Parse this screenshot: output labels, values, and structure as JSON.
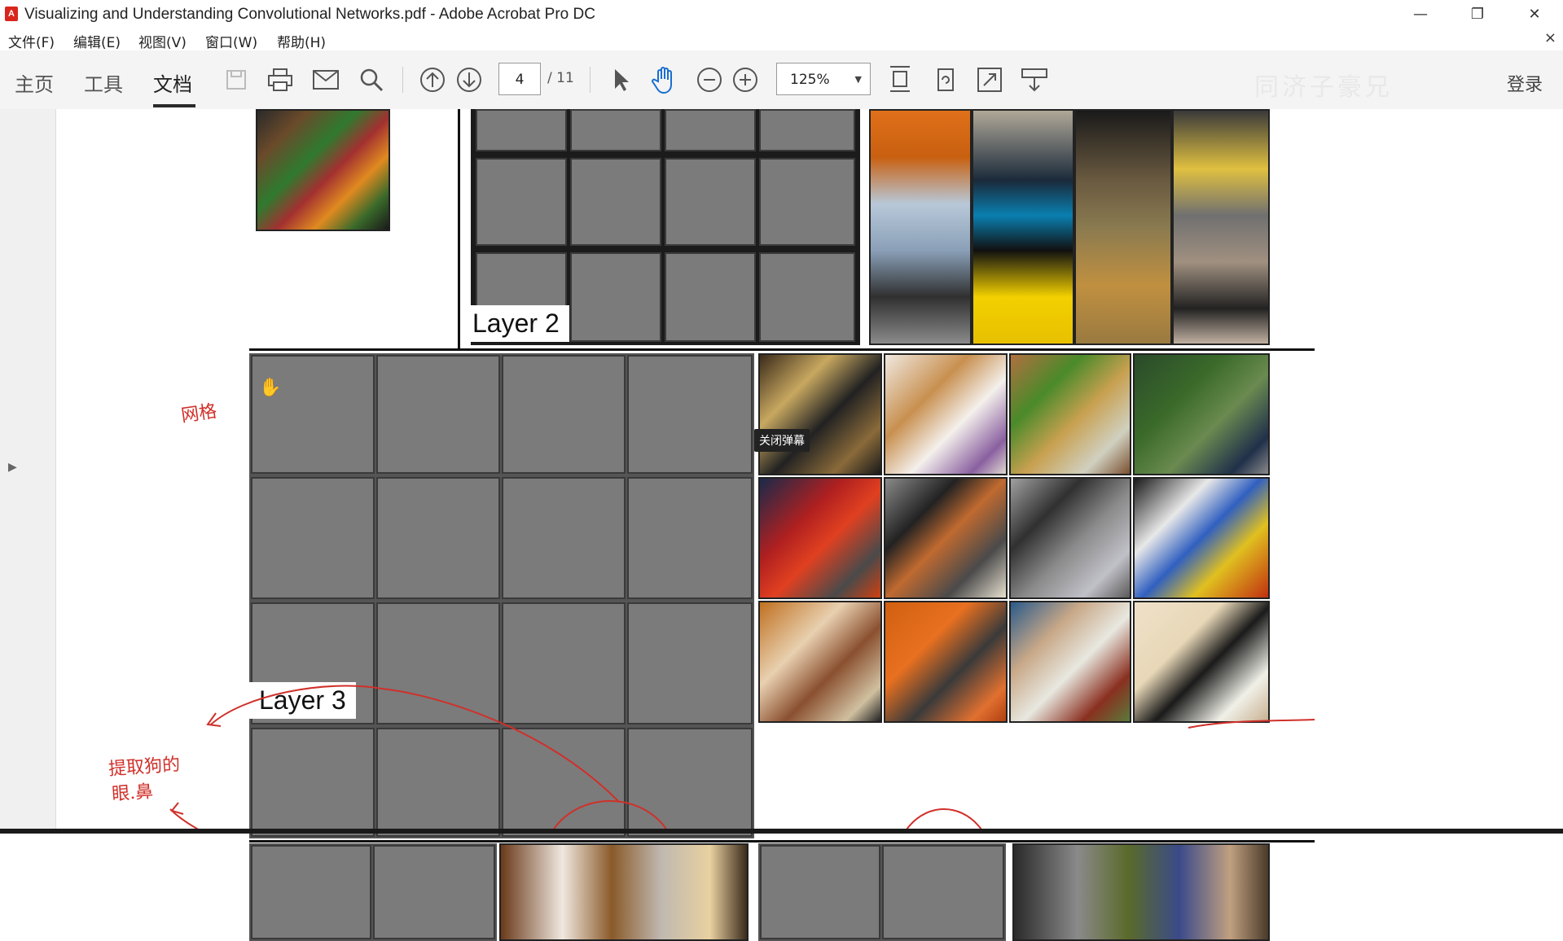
{
  "window": {
    "title": "Visualizing and Understanding Convolutional Networks.pdf - Adobe Acrobat Pro DC",
    "app_icon": "acrobat-icon",
    "controls": [
      "minimize-icon",
      "restore-icon",
      "close-icon"
    ]
  },
  "menu": {
    "items": [
      "文件(F)",
      "编辑(E)",
      "视图(V)",
      "窗口(W)",
      "帮助(H)"
    ],
    "close_glyph": "×"
  },
  "toolbar": {
    "tabs": [
      "主页",
      "工具",
      "文档"
    ],
    "active_tab": "文档",
    "page_current": "4",
    "page_total": "/ 11",
    "zoom": "125%",
    "watermark": "同济子豪兄",
    "login": "登录",
    "icons": [
      "save-icon",
      "print-icon",
      "email-icon",
      "search-icon",
      "page-up-icon",
      "page-down-icon",
      "select-arrow-icon",
      "hand-icon",
      "zoom-out-icon",
      "zoom-in-icon",
      "fit-page-icon",
      "rotate-icon",
      "fullscreen-icon",
      "read-mode-icon"
    ]
  },
  "document": {
    "layer2_label": "Layer 2",
    "layer3_label": "Layer 3",
    "tooltip": "关闭弹幕",
    "annotations": {
      "grid_note": "网格",
      "dog_note_line1": "提取狗的",
      "dog_note_line2": "眼.鼻"
    },
    "colors": {
      "annotation_red": "#d0302a",
      "acrobat_red": "#d9261c"
    }
  }
}
